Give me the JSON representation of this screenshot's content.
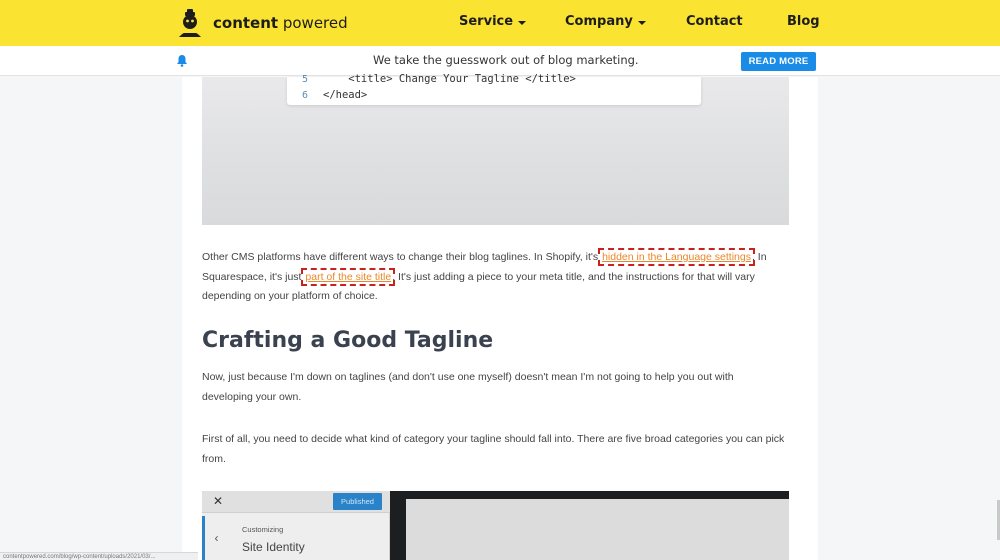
{
  "header": {
    "logo_bold": "content",
    "logo_regular": "powered",
    "nav": [
      {
        "label": "Service",
        "has_dropdown": true
      },
      {
        "label": "Company",
        "has_dropdown": true
      },
      {
        "label": "Contact",
        "has_dropdown": false
      },
      {
        "label": "Blog",
        "has_dropdown": false
      }
    ],
    "bg_color": "#fbe331"
  },
  "announcement": {
    "text": "We take the guesswork out of blog marketing.",
    "button_label": "READ MORE",
    "button_color": "#1a8be6"
  },
  "code_snippet": {
    "lines": [
      {
        "num": "5",
        "code": "    <title> Change Your Tagline </title>"
      },
      {
        "num": "6",
        "code": "</head>"
      }
    ]
  },
  "article": {
    "para1": {
      "before": "Other CMS platforms have different ways to change their blog taglines. In Shopify, it's ",
      "link1": "hidden in the Language settings",
      "middle1": ". In",
      "line2_start": "Squarespace, it's just ",
      "link2": "part of the site title",
      "after": ". It's just adding a piece to your meta title, and the instructions for that will vary",
      "line3": "depending on your platform of choice."
    },
    "heading": "Crafting a Good Tagline",
    "para2": {
      "line1": "Now, just because I'm down on taglines (and don't use one myself) doesn't mean I'm not going to help you out with",
      "line2": "developing your own."
    },
    "para3": {
      "line1": "First of all, you need to decide what kind of category your tagline should fall into. There are five broad categories you can pick",
      "line2": "from."
    },
    "link_color": "#e8872a"
  },
  "customizer_screenshot": {
    "close_glyph": "✕",
    "published_label": "Published",
    "back_glyph": "‹",
    "customizing_label": "Customizing",
    "section_label": "Site Identity"
  },
  "status_bar": {
    "url_text": "contentpowered.com/blog/wp-content/uploads/2021/03/..."
  }
}
